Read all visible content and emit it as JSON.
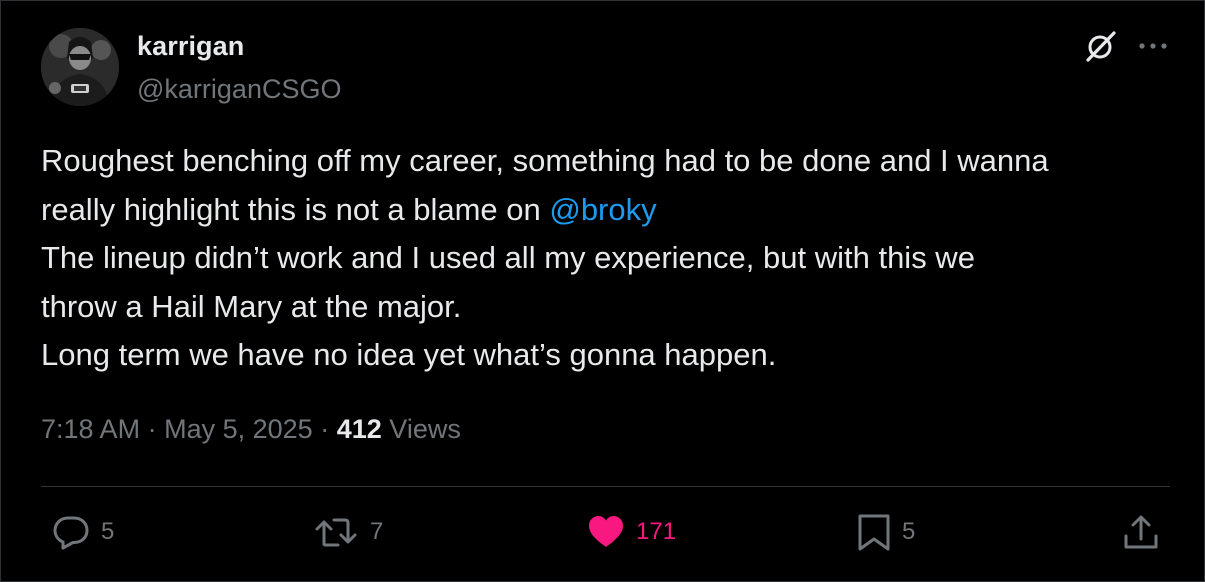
{
  "tweet": {
    "author_name": "karrigan",
    "author_handle": "@karriganCSGO",
    "lines": [
      {
        "before": "Roughest benching off my career, something had to be done and I wanna",
        "mention": "",
        "after": ""
      },
      {
        "before": "really highlight this is not a blame on ",
        "mention": "@broky",
        "after": ""
      },
      {
        "before": "The lineup didn’t work and I used all my experience, but with this we",
        "mention": "",
        "after": ""
      },
      {
        "before": "throw a Hail Mary at the major.",
        "mention": "",
        "after": ""
      },
      {
        "before": "Long term we have no idea yet what’s gonna happen.",
        "mention": "",
        "after": ""
      }
    ],
    "time": "7:18 AM",
    "separator": "·",
    "date": "May 5, 2025",
    "views_count": "412",
    "views_label": "Views"
  },
  "actions": {
    "reply_count": "5",
    "repost_count": "7",
    "like_count": "171",
    "bookmark_count": "5"
  },
  "icons": {
    "grok": "grok-icon",
    "more": "more-icon",
    "reply": "reply-icon",
    "repost": "repost-icon",
    "like": "heart-icon",
    "bookmark": "bookmark-icon",
    "share": "share-icon"
  },
  "colors": {
    "background": "#000000",
    "text": "#e7e9ea",
    "muted": "#71767b",
    "mention": "#1d9bf0",
    "like": "#f91880"
  }
}
